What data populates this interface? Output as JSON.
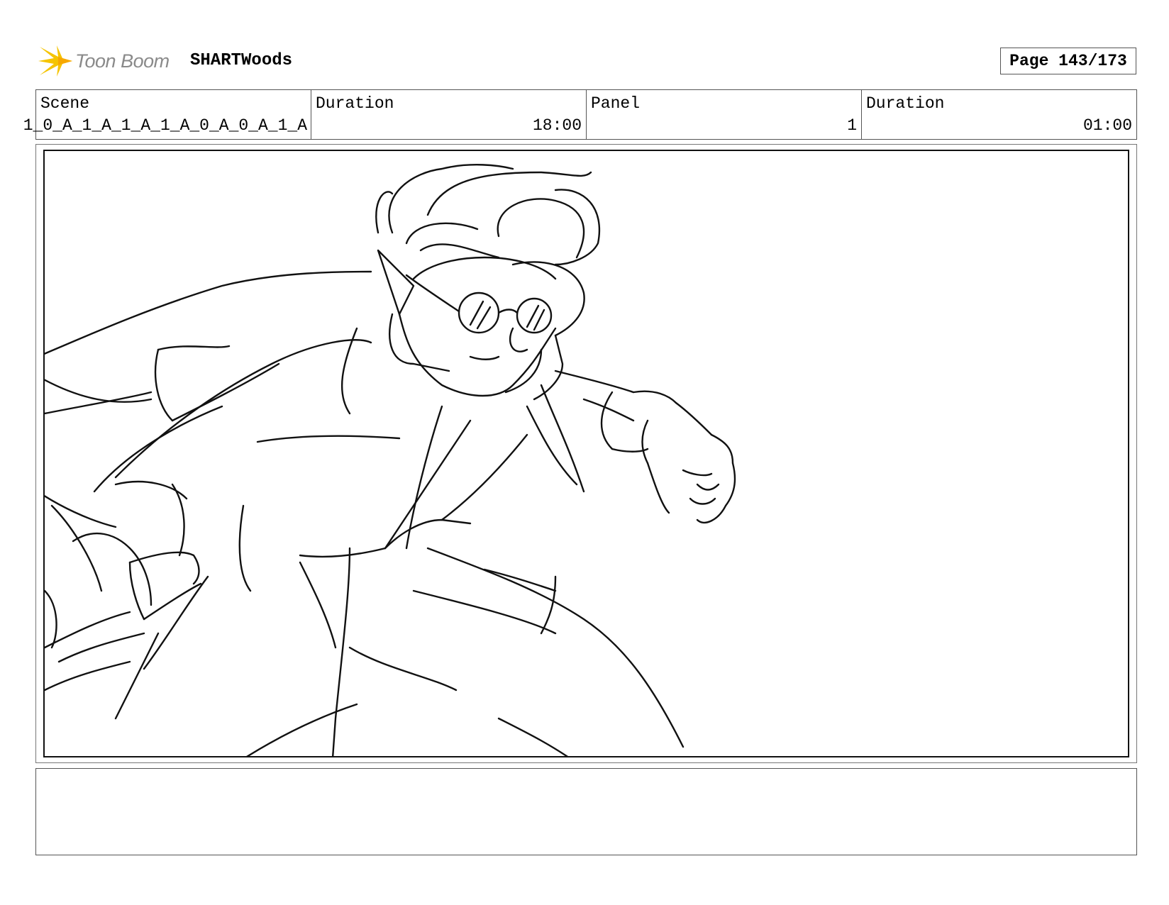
{
  "header": {
    "logo_text": "Toon Boom",
    "project": "SHARTWoods",
    "page": "Page 143/173"
  },
  "info": {
    "scene_label": "Scene",
    "scene_value": "1_0_A_1_A_1_A_1_A_0_A_0_A_1_A",
    "scene_duration_label": "Duration",
    "scene_duration_value": "18:00",
    "panel_label": "Panel",
    "panel_value": "1",
    "panel_duration_label": "Duration",
    "panel_duration_value": "01:00"
  },
  "colors": {
    "logo_yellow": "#f5c400",
    "logo_text": "#8a8a8a",
    "border": "#555555",
    "ink": "#111111"
  },
  "icons": {
    "logo": "toon-boom-star-icon"
  }
}
